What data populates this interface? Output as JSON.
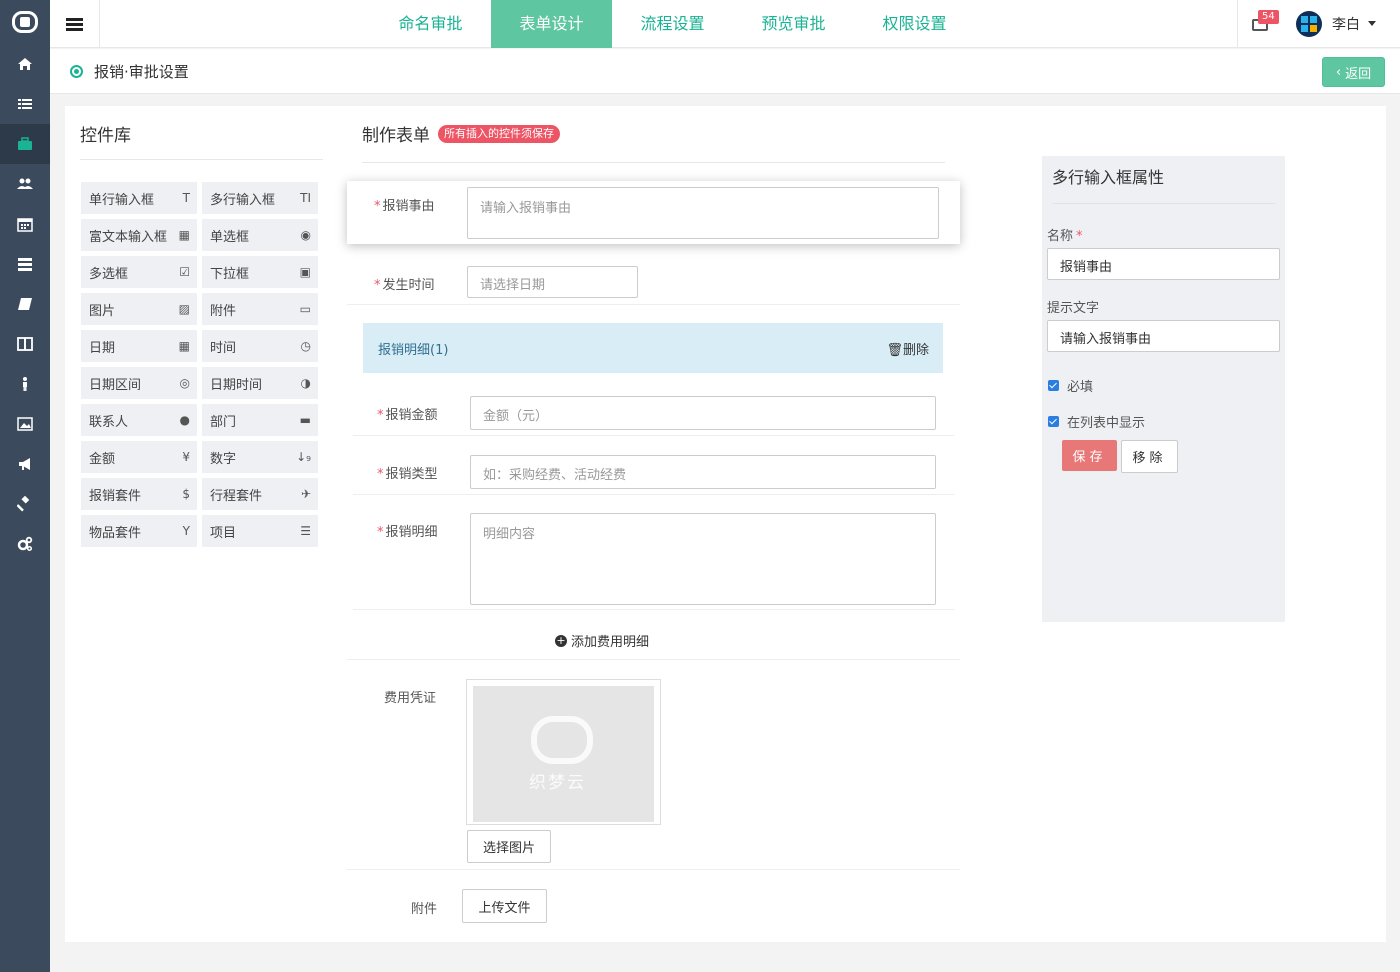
{
  "sidebar": {
    "items": [
      {
        "icon": "home-icon"
      },
      {
        "icon": "list-icon"
      },
      {
        "icon": "briefcase-icon"
      },
      {
        "icon": "users-icon"
      },
      {
        "icon": "calendar-icon"
      },
      {
        "icon": "server-icon"
      },
      {
        "icon": "book-icon"
      },
      {
        "icon": "columns-icon"
      },
      {
        "icon": "person-icon"
      },
      {
        "icon": "image-icon"
      },
      {
        "icon": "bullhorn-icon"
      },
      {
        "icon": "gavel-icon"
      },
      {
        "icon": "gears-icon"
      }
    ],
    "active_index": 2
  },
  "topnav": {
    "tabs": [
      "命名审批",
      "表单设计",
      "流程设置",
      "预览审批",
      "权限设置"
    ],
    "active_tab": 1,
    "mail_badge": "54",
    "username": "李白"
  },
  "breadcrumb": {
    "title": "报销·审批设置",
    "back_label": "返回"
  },
  "library": {
    "title": "控件库",
    "controls": [
      {
        "label": "单行输入框",
        "icon": "T"
      },
      {
        "label": "多行输入框",
        "icon": "TI"
      },
      {
        "label": "富文本输入框",
        "icon": "▦"
      },
      {
        "label": "单选框",
        "icon": "◉"
      },
      {
        "label": "多选框",
        "icon": "☑"
      },
      {
        "label": "下拉框",
        "icon": "▣"
      },
      {
        "label": "图片",
        "icon": "▨"
      },
      {
        "label": "附件",
        "icon": "▭"
      },
      {
        "label": "日期",
        "icon": "▦"
      },
      {
        "label": "时间",
        "icon": "◷"
      },
      {
        "label": "日期区间",
        "icon": "◎"
      },
      {
        "label": "日期时间",
        "icon": "◑"
      },
      {
        "label": "联系人",
        "icon": "●"
      },
      {
        "label": "部门",
        "icon": "▬"
      },
      {
        "label": "金额",
        "icon": "¥"
      },
      {
        "label": "数字",
        "icon": "↓₉"
      },
      {
        "label": "报销套件",
        "icon": "$"
      },
      {
        "label": "行程套件",
        "icon": "✈"
      },
      {
        "label": "物品套件",
        "icon": "Y"
      },
      {
        "label": "项目",
        "icon": "☰"
      }
    ]
  },
  "form": {
    "title": "制作表单",
    "tag": "所有插入的控件须保存",
    "reason_label": "报销事由",
    "reason_placeholder": "请输入报销事由",
    "time_label": "发生时间",
    "time_placeholder": "请选择日期",
    "detail_title": "报销明细(1)",
    "detail_delete": "删除",
    "amount_label": "报销金额",
    "amount_placeholder": "金额（元）",
    "type_label": "报销类型",
    "type_placeholder": "如：采购经费、活动经费",
    "desc_label": "报销明细",
    "desc_placeholder": "明细内容",
    "add_detail": "添加费用明细",
    "voucher_label": "费用凭证",
    "voucher_watermark": "织梦云",
    "choose_image": "选择图片",
    "attach_label": "附件",
    "upload_file": "上传文件"
  },
  "props": {
    "title": "多行输入框属性",
    "name_label": "名称",
    "name_value": "报销事由",
    "hint_label": "提示文字",
    "hint_value": "请输入报销事由",
    "required_label": "必填",
    "show_in_list_label": "在列表中显示",
    "save": "保存",
    "remove": "移除"
  }
}
